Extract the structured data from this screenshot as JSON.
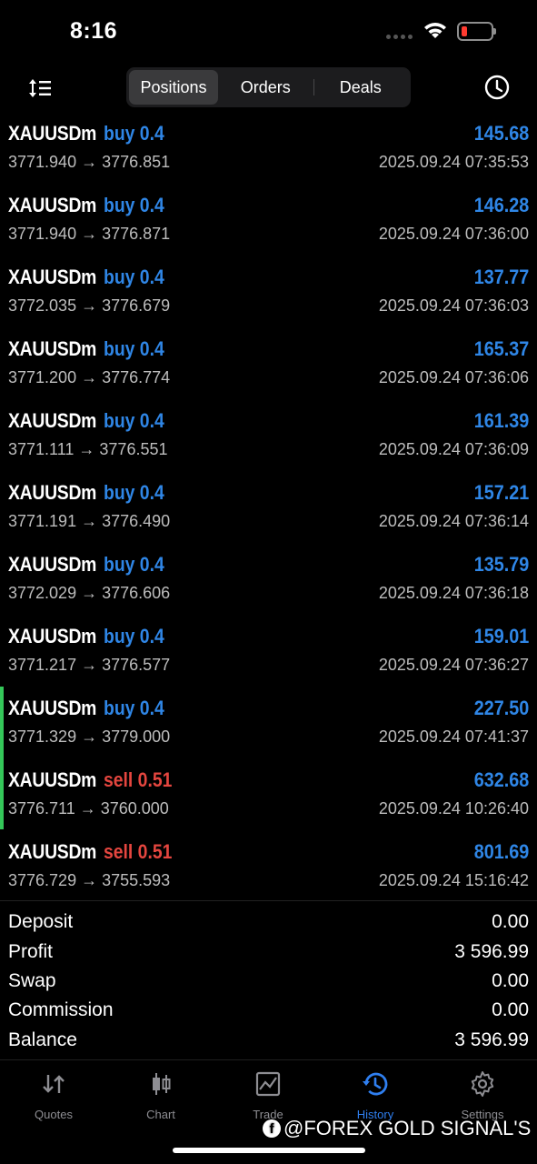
{
  "status": {
    "time": "8:16"
  },
  "tabs": {
    "segments": [
      "Positions",
      "Orders",
      "Deals"
    ],
    "active": "Positions"
  },
  "deals": [
    {
      "symbol": "XAUUSDm",
      "direction": "buy 0.4",
      "side": "buy",
      "profit": "145.68",
      "prices": "3771.940 → 3776.851",
      "time": "2025.09.24 07:35:53"
    },
    {
      "symbol": "XAUUSDm",
      "direction": "buy 0.4",
      "side": "buy",
      "profit": "146.28",
      "prices": "3771.940 → 3776.871",
      "time": "2025.09.24 07:36:00"
    },
    {
      "symbol": "XAUUSDm",
      "direction": "buy 0.4",
      "side": "buy",
      "profit": "137.77",
      "prices": "3772.035 → 3776.679",
      "time": "2025.09.24 07:36:03"
    },
    {
      "symbol": "XAUUSDm",
      "direction": "buy 0.4",
      "side": "buy",
      "profit": "165.37",
      "prices": "3771.200 → 3776.774",
      "time": "2025.09.24 07:36:06"
    },
    {
      "symbol": "XAUUSDm",
      "direction": "buy 0.4",
      "side": "buy",
      "profit": "161.39",
      "prices": "3771.111 → 3776.551",
      "time": "2025.09.24 07:36:09"
    },
    {
      "symbol": "XAUUSDm",
      "direction": "buy 0.4",
      "side": "buy",
      "profit": "157.21",
      "prices": "3771.191 → 3776.490",
      "time": "2025.09.24 07:36:14"
    },
    {
      "symbol": "XAUUSDm",
      "direction": "buy 0.4",
      "side": "buy",
      "profit": "135.79",
      "prices": "3772.029 → 3776.606",
      "time": "2025.09.24 07:36:18"
    },
    {
      "symbol": "XAUUSDm",
      "direction": "buy 0.4",
      "side": "buy",
      "profit": "159.01",
      "prices": "3771.217 → 3776.577",
      "time": "2025.09.24 07:36:27"
    },
    {
      "symbol": "XAUUSDm",
      "direction": "buy 0.4",
      "side": "buy",
      "profit": "227.50",
      "prices": "3771.329 → 3779.000",
      "time": "2025.09.24 07:41:37"
    },
    {
      "symbol": "XAUUSDm",
      "direction": "sell 0.51",
      "side": "sell",
      "profit": "632.68",
      "prices": "3776.711 → 3760.000",
      "time": "2025.09.24 10:26:40"
    },
    {
      "symbol": "XAUUSDm",
      "direction": "sell 0.51",
      "side": "sell",
      "profit": "801.69",
      "prices": "3776.729 → 3755.593",
      "time": "2025.09.24 15:16:42"
    }
  ],
  "summary": [
    {
      "label": "Deposit",
      "value": "0.00"
    },
    {
      "label": "Profit",
      "value": "3 596.99"
    },
    {
      "label": "Swap",
      "value": "0.00"
    },
    {
      "label": "Commission",
      "value": "0.00"
    },
    {
      "label": "Balance",
      "value": "3 596.99"
    }
  ],
  "bottom_nav": [
    {
      "label": "Quotes",
      "icon": "quotes-icon"
    },
    {
      "label": "Chart",
      "icon": "candlestick-icon"
    },
    {
      "label": "Trade",
      "icon": "trade-chart-icon"
    },
    {
      "label": "History",
      "icon": "history-icon"
    },
    {
      "label": "Settings",
      "icon": "gear-icon"
    }
  ],
  "active_nav": "History",
  "watermark": "@FOREX GOLD SIGNAL'S",
  "colors": {
    "buy": "#2f86e6",
    "sell": "#e5463f",
    "accent": "#2f7ff0",
    "marker": "#34c759"
  }
}
